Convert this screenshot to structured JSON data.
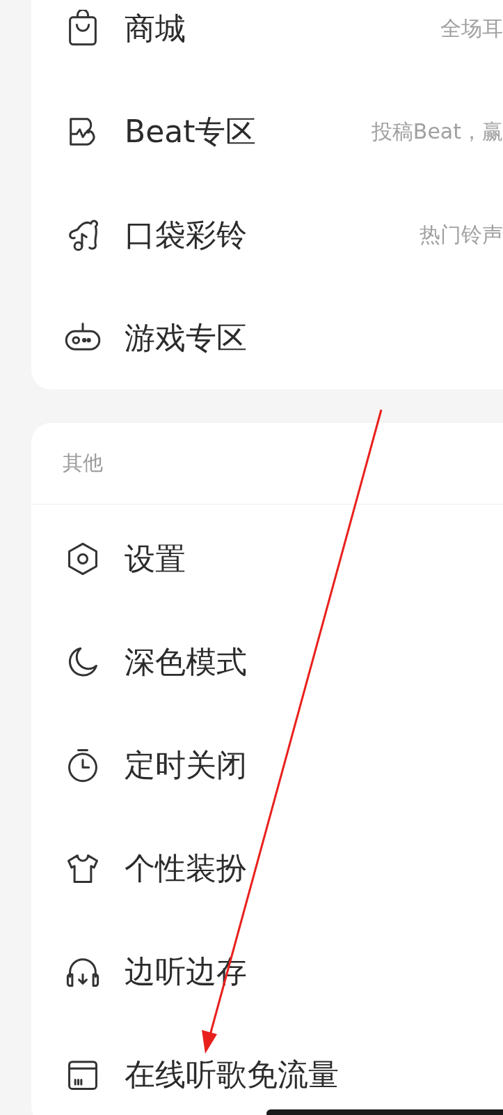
{
  "sections": [
    {
      "items": [
        {
          "label": "商城",
          "subtitle": "全场耳"
        },
        {
          "label": "Beat专区",
          "subtitle": "投稿Beat，赢"
        },
        {
          "label": "口袋彩铃",
          "subtitle": "热门铃声"
        },
        {
          "label": "游戏专区"
        }
      ]
    },
    {
      "title": "其他",
      "items": [
        {
          "label": "设置"
        },
        {
          "label": "深色模式"
        },
        {
          "label": "定时关闭"
        },
        {
          "label": "个性装扮"
        },
        {
          "label": "边听边存"
        },
        {
          "label": "在线听歌免流量"
        }
      ]
    }
  ]
}
